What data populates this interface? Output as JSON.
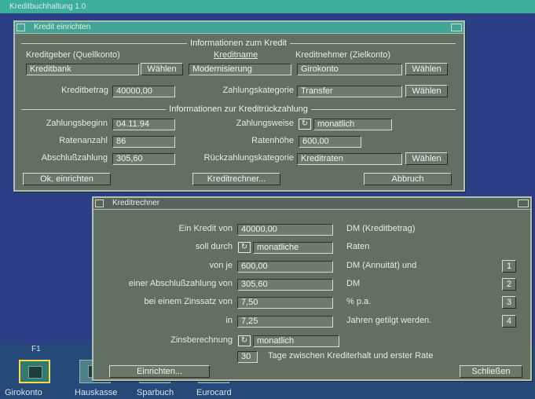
{
  "app": {
    "title": "Kreditbuchhaltung 1.0"
  },
  "win1": {
    "title": "Kredit einrichten",
    "sec1": "Informationen zum Kredit",
    "col_geber": "Kreditgeber (Quellkonto)",
    "col_name": "Kreditname",
    "col_nehmer": "Kreditnehmer (Zielkonto)",
    "geber": "Kreditbank",
    "name": "Modernisierung",
    "nehmer": "Girokonto",
    "choose": "Wählen",
    "betrag_label": "Kreditbetrag",
    "betrag": "40000,00",
    "zkat_label": "Zahlungskategorie",
    "zkat": "Transfer",
    "sec2": "Informationen zur Kreditrückzahlung",
    "beginn_label": "Zahlungsbeginn",
    "beginn": "04.11.94",
    "weise_label": "Zahlungsweise",
    "weise": "monatlich",
    "anzahl_label": "Ratenanzahl",
    "anzahl": "86",
    "hoehe_label": "Ratenhöhe",
    "hoehe": "600,00",
    "abschluss_label": "Abschlußzahlung",
    "abschluss": "305,60",
    "rkat_label": "Rückzahlungskategorie",
    "rkat": "Kreditraten",
    "ok": "Ok, einrichten",
    "rechner": "Kreditrechner...",
    "abbruch": "Abbruch"
  },
  "win2": {
    "title": "Kreditrechner",
    "l1": "Ein Kredit von",
    "v1": "40000,00",
    "s1": "DM (Kreditbetrag)",
    "l2": "soll durch",
    "v2": "monatliche",
    "s2": "Raten",
    "l3": "von je",
    "v3": "600,00",
    "s3": "DM (Annuität) und",
    "b3": "1",
    "l4": "einer Abschlußzahlung von",
    "v4": "305,60",
    "s4": "DM",
    "b4": "2",
    "l5": "bei einem Zinssatz von",
    "v5": "7,50",
    "s5": "% p.a.",
    "b5": "3",
    "l6": "in",
    "v6": "7,25",
    "s6": "Jahren getilgt werden.",
    "b6": "4",
    "l7": "Zinsberechnung",
    "v7": "monatlich",
    "v8": "30",
    "s8": "Tage zwischen Krediterhalt und erster Rate",
    "einrichten": "Einrichten...",
    "schliessen": "Schließen"
  },
  "desktop": {
    "f1": "F1",
    "icons": [
      "Girokonto",
      "Hauskasse",
      "Sparbuch",
      "Eurocard"
    ]
  }
}
